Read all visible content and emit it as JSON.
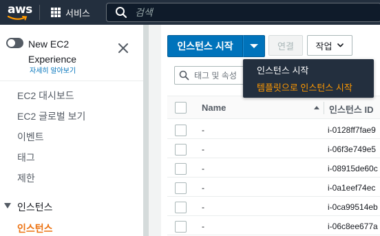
{
  "topnav": {
    "logo_text": "aws",
    "services_label": "서비스",
    "search_placeholder": "검색"
  },
  "sidebar": {
    "experience_title": "New EC2 Experience",
    "learn_more": "자세히 알아보기",
    "items": [
      {
        "label": "EC2 대시보드"
      },
      {
        "label": "EC2 글로벌 보기"
      },
      {
        "label": "이벤트"
      },
      {
        "label": "태그"
      },
      {
        "label": "제한"
      }
    ],
    "section": "인스턴스",
    "active_item": "인스턴스"
  },
  "toolbar": {
    "launch_label": "인스턴스 시작",
    "connect_label": "연결",
    "actions_label": "작업"
  },
  "filter": {
    "placeholder": "태그 및 속성"
  },
  "table": {
    "columns": [
      "Name",
      "인스턴스 ID"
    ],
    "rows": [
      {
        "name": "-",
        "id": "i-0128ff7fae9"
      },
      {
        "name": "-",
        "id": "i-06f3e749e5"
      },
      {
        "name": "-",
        "id": "i-08915de60c"
      },
      {
        "name": "-",
        "id": "i-0a1eef74ec"
      },
      {
        "name": "-",
        "id": "i-0ca99514eb"
      },
      {
        "name": "-",
        "id": "i-06c8ee677a"
      }
    ]
  },
  "dropdown": {
    "items": [
      "인스턴스 시작",
      "템플릿으로 인스턴스 시작"
    ]
  },
  "colors": {
    "nav_bg": "#232f3e",
    "primary": "#0073bb",
    "accent_orange": "#ec7211",
    "dropdown_highlight": "#ff9900"
  }
}
